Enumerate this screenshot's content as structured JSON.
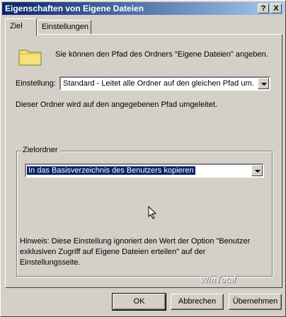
{
  "window": {
    "title": "Eigenschaften von Eigene Dateien",
    "help_label": "?",
    "close_label": "X"
  },
  "tabs": [
    {
      "label": "Ziel"
    },
    {
      "label": "Einstellungen"
    }
  ],
  "ziel": {
    "intro": "Sie können den Pfad des Ordners \"Eigene Dateien\" angeben.",
    "setting_label": "Einstellung:",
    "setting_value": "Standard - Leitet alle Ordner auf den gleichen Pfad um.",
    "redirect_note": "Dieser Ordner wird auf den angegebenen Pfad umgeleitet.",
    "target_group_label": "Zielordner",
    "target_value": "In das Basisverzeichnis des Benutzers kopieren",
    "hint_line1": "Hinweis: Diese Einstellung ignoriert den Wert der Option \"Benutzer",
    "hint_line2": "exklusiven Zugriff auf Eigene Dateien erteilen\" auf der",
    "hint_line3": "Einstellungsseite."
  },
  "watermark": "WinTotal",
  "buttons": {
    "ok": "OK",
    "cancel": "Abbrechen",
    "apply": "Übernehmen"
  },
  "colors": {
    "titlebar_start": "#0a246a",
    "titlebar_end": "#a6caf0",
    "face": "#d4d0c8",
    "selection": "#0a246a",
    "folder": "#f3e27a"
  }
}
